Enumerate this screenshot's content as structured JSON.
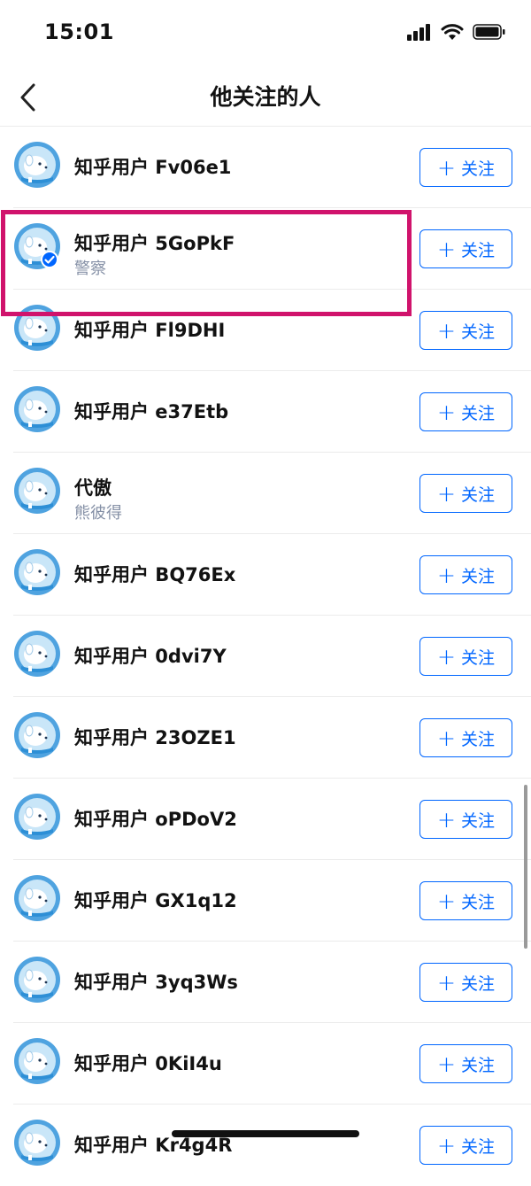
{
  "status_bar": {
    "time": "15:01"
  },
  "nav": {
    "title": "他关注的人"
  },
  "follow_label": "关注",
  "users": [
    {
      "name": "知乎用户 Fv06e1",
      "subtitle": ""
    },
    {
      "name": "知乎用户 5GoPkF",
      "subtitle": "警察",
      "verified": true
    },
    {
      "name": "知乎用户 Fl9DHI",
      "subtitle": ""
    },
    {
      "name": "知乎用户 e37Etb",
      "subtitle": ""
    },
    {
      "name": "代傲",
      "subtitle": "熊彼得"
    },
    {
      "name": "知乎用户 BQ76Ex",
      "subtitle": ""
    },
    {
      "name": "知乎用户 0dvi7Y",
      "subtitle": ""
    },
    {
      "name": "知乎用户 23OZE1",
      "subtitle": ""
    },
    {
      "name": "知乎用户 oPDoV2",
      "subtitle": ""
    },
    {
      "name": "知乎用户 GX1q12",
      "subtitle": ""
    },
    {
      "name": "知乎用户 3yq3Ws",
      "subtitle": ""
    },
    {
      "name": "知乎用户 0KiI4u",
      "subtitle": ""
    },
    {
      "name": "知乎用户 Kr4g4R",
      "subtitle": ""
    }
  ],
  "colors": {
    "accent": "#0066ff",
    "highlight": "#d0136c",
    "subtitle": "#8590a6",
    "avatar_bg": "#4fa3e0"
  },
  "icons": {
    "back": "chevron-left-icon",
    "avatar": "default-avatar-icon",
    "verified": "verified-badge-icon",
    "plus": "plus-icon"
  }
}
